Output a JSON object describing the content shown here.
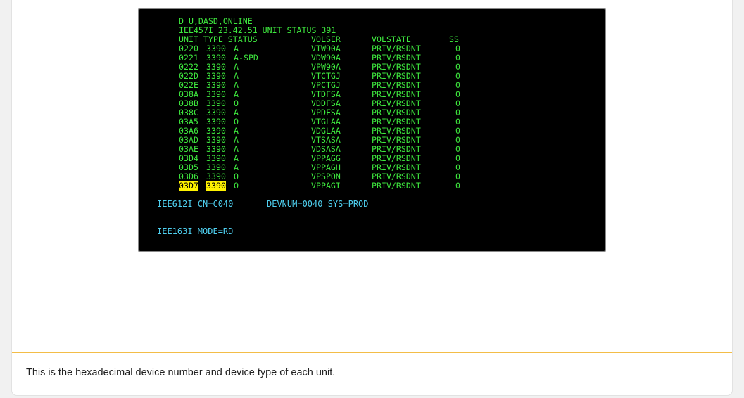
{
  "terminal": {
    "command": "D U,DASD,ONLINE",
    "status_header": "IEE457I 23.42.51 UNIT STATUS 391",
    "columns": {
      "unit_type_status": "UNIT TYPE STATUS",
      "volser": "VOLSER",
      "volstate": "VOLSTATE",
      "ss": "SS"
    },
    "rows": [
      {
        "unit": "0220",
        "type": "3390",
        "status": "A",
        "volser": "VTW90A",
        "volstate": "PRIV/RSDNT",
        "ss": "0"
      },
      {
        "unit": "0221",
        "type": "3390",
        "status": "A-SPD",
        "volser": "VDW90A",
        "volstate": "PRIV/RSDNT",
        "ss": "0"
      },
      {
        "unit": "0222",
        "type": "3390",
        "status": "A",
        "volser": "VPW90A",
        "volstate": "PRIV/RSDNT",
        "ss": "0"
      },
      {
        "unit": "022D",
        "type": "3390",
        "status": "A",
        "volser": "VTCTGJ",
        "volstate": "PRIV/RSDNT",
        "ss": "0"
      },
      {
        "unit": "022E",
        "type": "3390",
        "status": "A",
        "volser": "VPCTGJ",
        "volstate": "PRIV/RSDNT",
        "ss": "0"
      },
      {
        "unit": "038A",
        "type": "3390",
        "status": "A",
        "volser": "VTDFSA",
        "volstate": "PRIV/RSDNT",
        "ss": "0"
      },
      {
        "unit": "038B",
        "type": "3390",
        "status": "O",
        "volser": "VDDFSA",
        "volstate": "PRIV/RSDNT",
        "ss": "0"
      },
      {
        "unit": "038C",
        "type": "3390",
        "status": "A",
        "volser": "VPDFSA",
        "volstate": "PRIV/RSDNT",
        "ss": "0"
      },
      {
        "unit": "03A5",
        "type": "3390",
        "status": "O",
        "volser": "VTGLAA",
        "volstate": "PRIV/RSDNT",
        "ss": "0"
      },
      {
        "unit": "03A6",
        "type": "3390",
        "status": "A",
        "volser": "VDGLAA",
        "volstate": "PRIV/RSDNT",
        "ss": "0"
      },
      {
        "unit": "03AD",
        "type": "3390",
        "status": "A",
        "volser": "VTSASA",
        "volstate": "PRIV/RSDNT",
        "ss": "0"
      },
      {
        "unit": "03AE",
        "type": "3390",
        "status": "A",
        "volser": "VDSASA",
        "volstate": "PRIV/RSDNT",
        "ss": "0"
      },
      {
        "unit": "03D4",
        "type": "3390",
        "status": "A",
        "volser": "VPPAGG",
        "volstate": "PRIV/RSDNT",
        "ss": "0"
      },
      {
        "unit": "03D5",
        "type": "3390",
        "status": "A",
        "volser": "VPPAGH",
        "volstate": "PRIV/RSDNT",
        "ss": "0"
      },
      {
        "unit": "03D6",
        "type": "3390",
        "status": "O",
        "volser": "VPSPON",
        "volstate": "PRIV/RSDNT",
        "ss": "0"
      },
      {
        "unit": "03D7",
        "type": "3390",
        "status": "O",
        "volser": "VPPAGI",
        "volstate": "PRIV/RSDNT",
        "ss": "0",
        "highlighted": true
      }
    ],
    "iee612i": "IEE612I CN=C040",
    "devnum_sys": "DEVNUM=0040 SYS=PROD",
    "iee163i": "IEE163I MODE=RD"
  },
  "caption": "This is the hexadecimal device number and device type of each unit.",
  "colors": {
    "terminal_bg": "#000000",
    "text_green": "#3ee83e",
    "text_cyan": "#4fd0f0",
    "highlight": "#fff200",
    "divider": "#f3bd47"
  }
}
